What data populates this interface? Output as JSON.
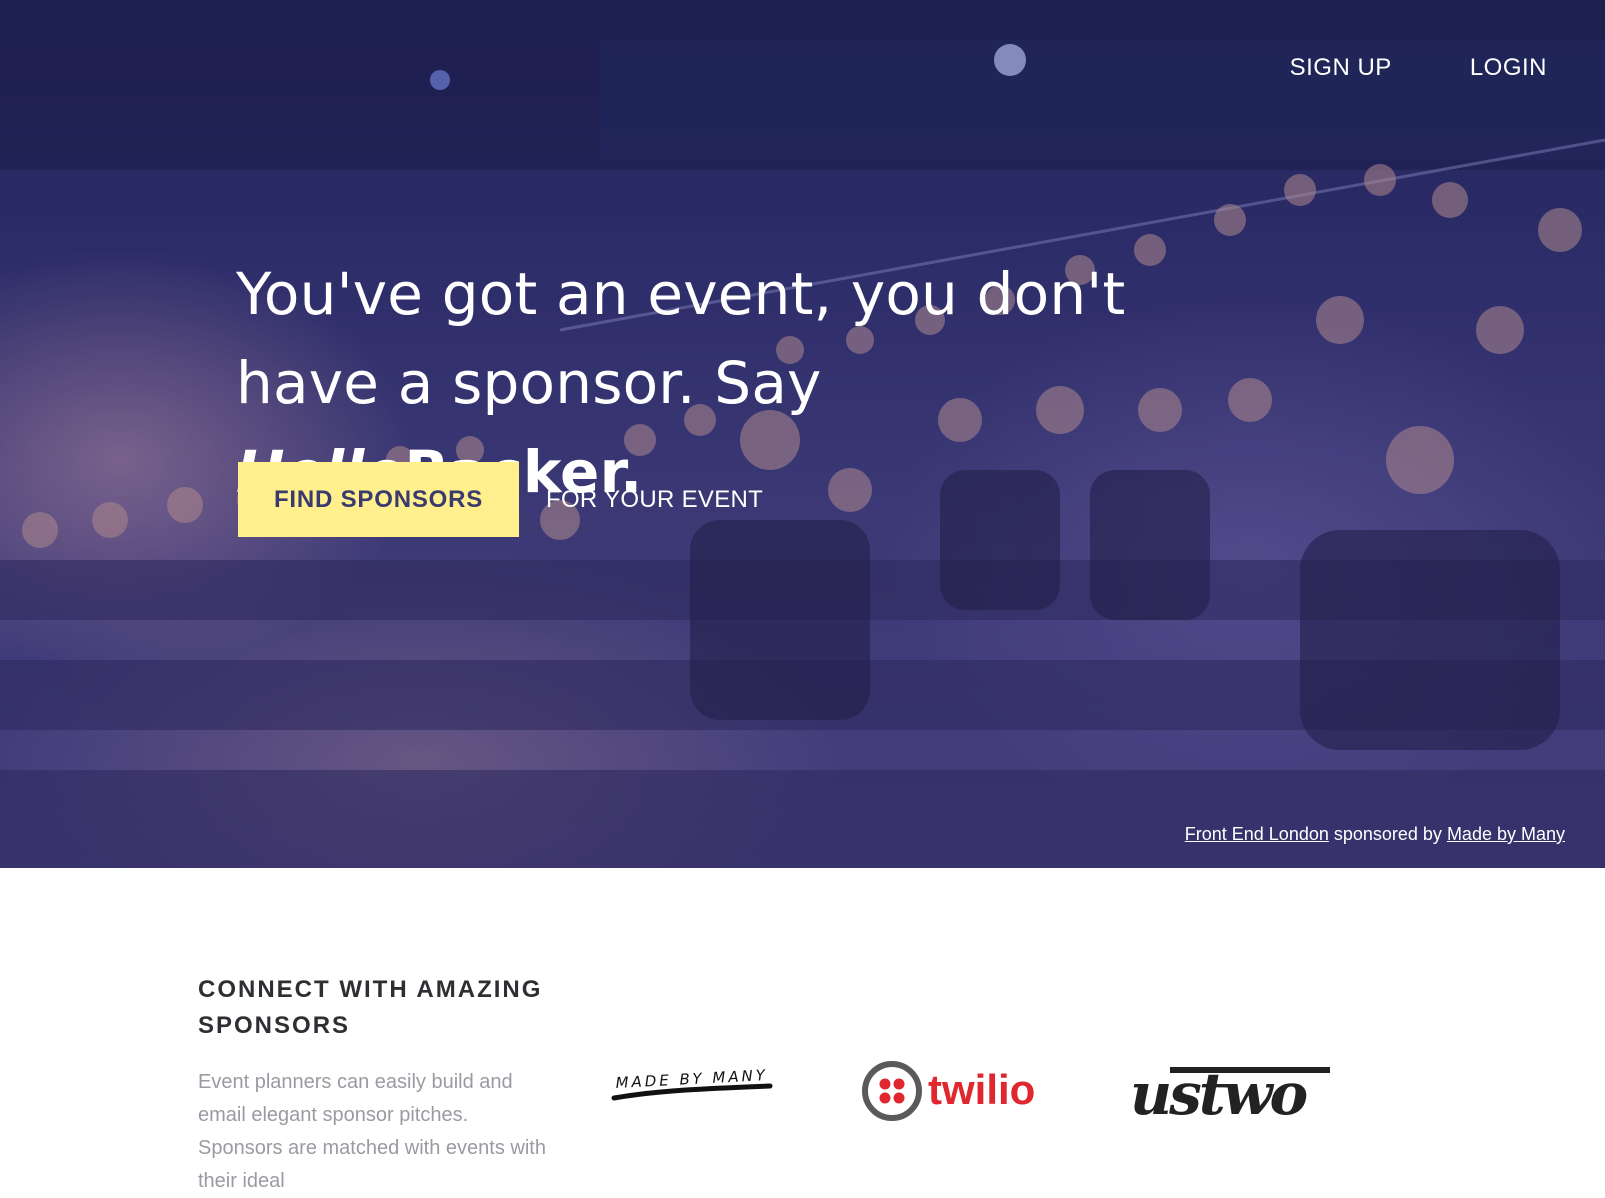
{
  "nav": {
    "signup_label": "SIGN UP",
    "login_label": "LOGIN"
  },
  "hero": {
    "headline_part1": "You've got an event, you don't have a sponsor. Say ",
    "brand_hello": "Hello",
    "brand_backer": "Backer.",
    "cta_label": "FIND SPONSORS",
    "cta_suffix": "FOR YOUR EVENT",
    "credit_event": "Front End London",
    "credit_mid": " sponsored by ",
    "credit_sponsor": "Made by Many"
  },
  "section": {
    "title": "CONNECT WITH AMAZING SPONSORS",
    "body": "Event planners can easily build and email elegant sponsor pitches. Sponsors are matched with events with their ideal",
    "logos": {
      "made_by_many": "MADE BY MANY",
      "twilio": "twilio",
      "ustwo": "ustwo"
    }
  },
  "colors": {
    "cta_bg": "#fff08d",
    "cta_text": "#3a3a6e",
    "twilio_red": "#e0262e",
    "hero_overlay": "#2b2b66"
  }
}
